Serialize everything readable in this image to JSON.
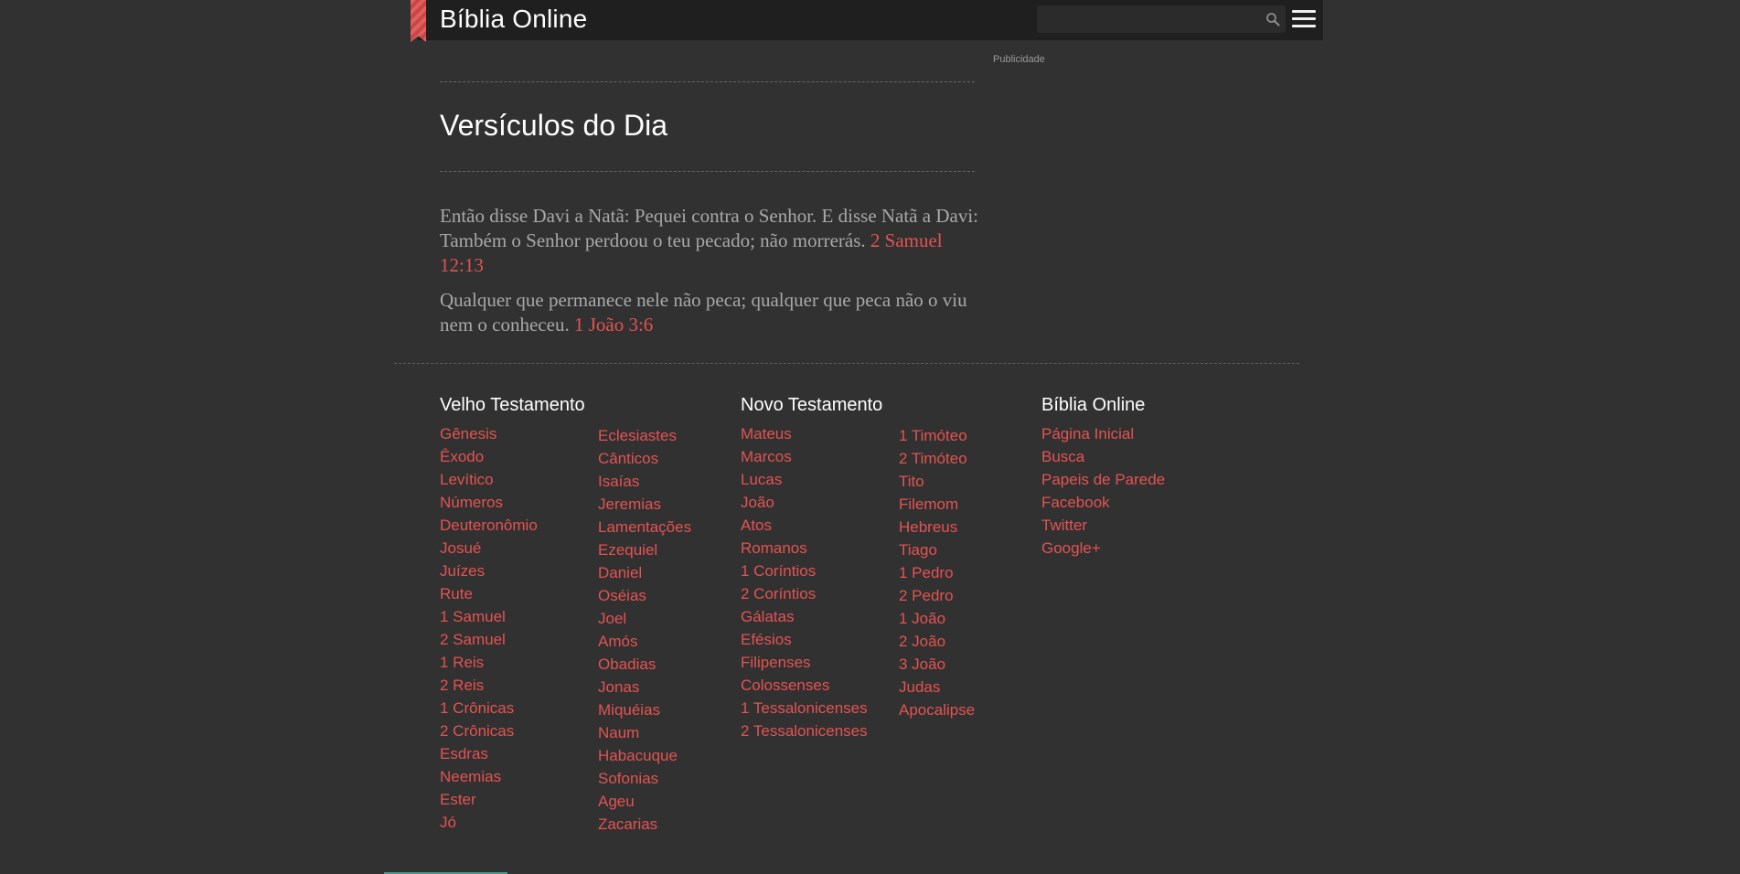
{
  "header": {
    "site_title": "Bíblia Online",
    "search_placeholder": "",
    "search_value": ""
  },
  "ad": {
    "label": "Publicidade"
  },
  "main": {
    "title": "Versículos do Dia",
    "verses": [
      {
        "text": "Então disse Davi a Natã: Pequei contra o Senhor. E disse Natã a Davi: Também o Senhor perdoou o teu pecado; não morrerás.",
        "reference": "2 Samuel 12:13"
      },
      {
        "text": "Qualquer que permanece nele não peca; qualquer que peca não o viu nem o conheceu.",
        "reference": "1 João 3:6"
      }
    ]
  },
  "footer": {
    "old_testament": {
      "title": "Velho Testamento",
      "col1": [
        "Gênesis",
        "Êxodo",
        "Levítico",
        "Números",
        "Deuteronômio",
        "Josué",
        "Juízes",
        "Rute",
        "1 Samuel",
        "2 Samuel",
        "1 Reis",
        "2 Reis",
        "1 Crônicas",
        "2 Crônicas",
        "Esdras",
        "Neemias",
        "Ester",
        "Jó"
      ],
      "col2": [
        "Eclesiastes",
        "Cânticos",
        "Isaías",
        "Jeremias",
        "Lamentações",
        "Ezequiel",
        "Daniel",
        "Oséias",
        "Joel",
        "Amós",
        "Obadias",
        "Jonas",
        "Miquéias",
        "Naum",
        "Habacuque",
        "Sofonias",
        "Ageu",
        "Zacarias"
      ]
    },
    "new_testament": {
      "title": "Novo Testamento",
      "col1": [
        "Mateus",
        "Marcos",
        "Lucas",
        "João",
        "Atos",
        "Romanos",
        "1 Coríntios",
        "2 Coríntios",
        "Gálatas",
        "Efésios",
        "Filipenses",
        "Colossenses",
        "1 Tessalonicenses",
        "2 Tessalonicenses"
      ],
      "col2": [
        "1 Timóteo",
        "2 Timóteo",
        "Tito",
        "Filemom",
        "Hebreus",
        "Tiago",
        "1 Pedro",
        "2 Pedro",
        "1 João",
        "2 João",
        "3 João",
        "Judas",
        "Apocalipse"
      ]
    },
    "site": {
      "title": "Bíblia Online",
      "links": [
        "Página Inicial",
        "Busca",
        "Papeis de Parede",
        "Facebook",
        "Twitter",
        "Google+"
      ]
    }
  },
  "colors": {
    "accent": "#e45252",
    "background": "#313131",
    "header": "#1f1f1f"
  }
}
